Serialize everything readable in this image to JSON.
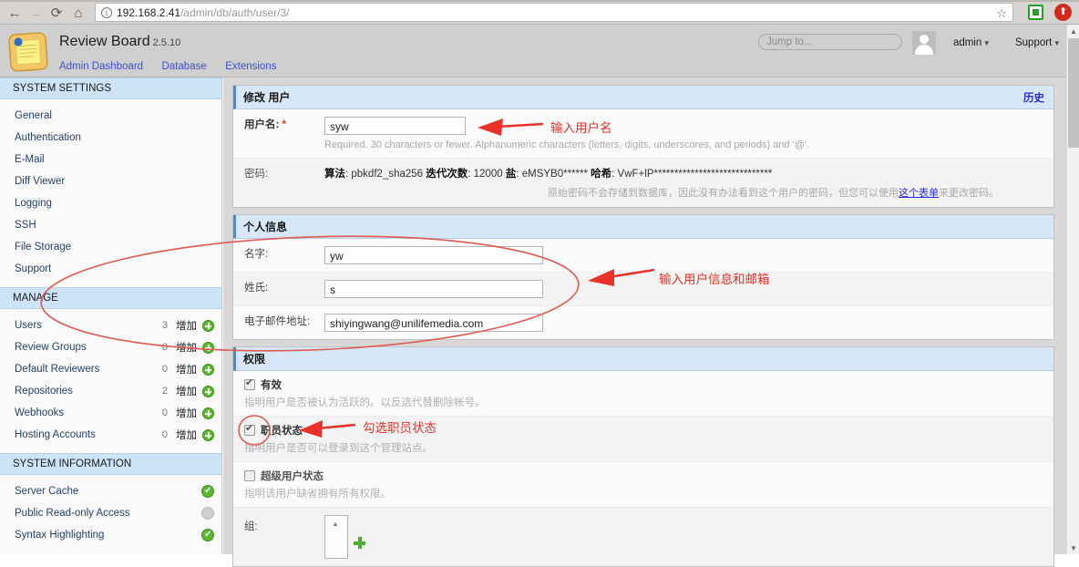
{
  "browser": {
    "back_icon": "arrow-left-icon",
    "forward_icon": "arrow-right-icon",
    "reload_icon": "reload-icon",
    "home_icon": "home-icon",
    "info_icon": "info-icon",
    "url_host": "192.168.2.41",
    "url_path": "/admin/db/auth/user/3/",
    "star_icon": "star-icon",
    "extension_green": "green-square-extension-icon",
    "extension_red": "red-circle-extension-icon"
  },
  "header": {
    "product": "Review Board",
    "version": "2.5.10",
    "nav": [
      {
        "label": "Admin Dashboard"
      },
      {
        "label": "Database"
      },
      {
        "label": "Extensions"
      }
    ],
    "jump_to_placeholder": "Jump to...",
    "user_label": "admin",
    "support_label": "Support",
    "caret": "▾"
  },
  "sidebar": {
    "sections": [
      {
        "title": "SYSTEM SETTINGS",
        "items": [
          {
            "label": "General"
          },
          {
            "label": "Authentication"
          },
          {
            "label": "E-Mail"
          },
          {
            "label": "Diff Viewer"
          },
          {
            "label": "Logging"
          },
          {
            "label": "SSH"
          },
          {
            "label": "File Storage"
          },
          {
            "label": "Support"
          }
        ]
      },
      {
        "title": "MANAGE",
        "items": [
          {
            "label": "Users",
            "count": "3",
            "add": "增加"
          },
          {
            "label": "Review Groups",
            "count": "0",
            "add": "增加"
          },
          {
            "label": "Default Reviewers",
            "count": "0",
            "add": "增加"
          },
          {
            "label": "Repositories",
            "count": "2",
            "add": "增加"
          },
          {
            "label": "Webhooks",
            "count": "0",
            "add": "增加"
          },
          {
            "label": "Hosting Accounts",
            "count": "0",
            "add": "增加"
          }
        ]
      },
      {
        "title": "SYSTEM INFORMATION",
        "items": [
          {
            "label": "Server Cache",
            "status": "ok"
          },
          {
            "label": "Public Read-only Access",
            "status": "off"
          },
          {
            "label": "Syntax Highlighting",
            "status": "ok"
          }
        ]
      }
    ]
  },
  "form": {
    "user_panel": {
      "title": "修改 用户",
      "history_link": "历史",
      "username_label": "用户名:",
      "username_required_mark": "*",
      "username_value": "syw",
      "username_help": "Required. 30 characters or fewer. Alphanumeric characters (letters, digits, underscores, and periods) and '@'.",
      "password_label": "密码:",
      "password_algo_label": "算法",
      "password_algo_value": "pbkdf2_sha256",
      "password_iter_label": "迭代次数",
      "password_iter_value": "12000",
      "password_salt_label": "盐",
      "password_salt_value": "eMSYB0******",
      "password_hash_label": "哈希",
      "password_hash_value": "VwF+lP*****************************",
      "password_help_pre": "原始密码不会存储到数据库，因此没有办法看到这个用户的密码，但您可以使用",
      "password_help_link": "这个表单",
      "password_help_post": "来更改密码。"
    },
    "personal_panel": {
      "title": "个人信息",
      "first_name_label": "名字:",
      "first_name_value": "yw",
      "last_name_label": "姓氏:",
      "last_name_value": "s",
      "email_label": "电子邮件地址:",
      "email_value": "shiyingwang@unilifemedia.com"
    },
    "permissions_panel": {
      "title": "权限",
      "active_label": "有效",
      "active_checked": true,
      "active_help": "指明用户是否被认为活跃的。以反选代替删除帐号。",
      "staff_label": "职员状态",
      "staff_checked": true,
      "staff_help": "指明用户是否可以登录到这个管理站点。",
      "superuser_label": "超级用户状态",
      "superuser_checked": false,
      "superuser_help": "指明该用户缺省拥有所有权限。",
      "groups_label": "组:"
    }
  },
  "annotations": {
    "color": "#e8322b",
    "items": [
      {
        "text": "输入用户名"
      },
      {
        "text": "输入用户信息和邮箱"
      },
      {
        "text": "勾选职员状态"
      }
    ]
  },
  "colors": {
    "accent_blue": "#d6e7f7",
    "sidebar_header": "#cde3f7",
    "link": "#2a2ae0",
    "green": "#5bb831",
    "annotation_red": "#e8322b"
  }
}
